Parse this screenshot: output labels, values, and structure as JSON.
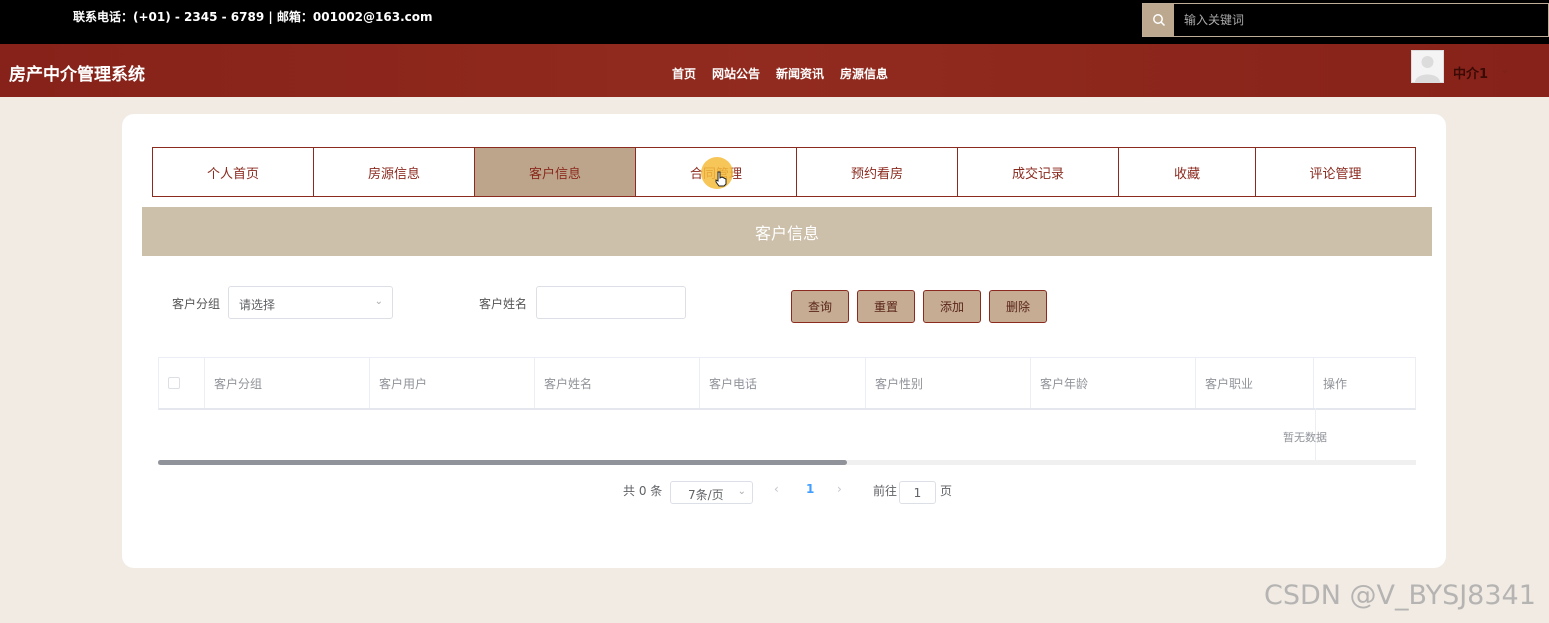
{
  "topbar": {
    "contact": "联系电话：(+01) - 2345 - 6789 | 邮箱：001002@163.com",
    "search_placeholder": "输入关键词",
    "search_icon": "search-icon"
  },
  "header": {
    "title": "房产中介管理系统",
    "nav": [
      "首页",
      "网站公告",
      "新闻资讯",
      "房源信息"
    ],
    "user_name": "中介1",
    "user_caret": "⌄"
  },
  "tabs": [
    {
      "label": "个人首页",
      "active": false
    },
    {
      "label": "房源信息",
      "active": false
    },
    {
      "label": "客户信息",
      "active": true
    },
    {
      "label": "合同管理",
      "active": false
    },
    {
      "label": "预约看房",
      "active": false
    },
    {
      "label": "成交记录",
      "active": false
    },
    {
      "label": "收藏",
      "active": false
    },
    {
      "label": "评论管理",
      "active": false
    }
  ],
  "banner": "客户信息",
  "filters": {
    "group_label": "客户分组",
    "group_value": "请选择",
    "name_label": "客户姓名",
    "name_value": ""
  },
  "buttons": {
    "query": "查询",
    "reset": "重置",
    "add": "添加",
    "delete": "删除"
  },
  "table": {
    "columns": [
      "客户分组",
      "客户用户",
      "客户姓名",
      "客户电话",
      "客户性别",
      "客户年龄",
      "客户职业",
      "操作"
    ],
    "empty_text": "暂无数据"
  },
  "pagination": {
    "total": "共 0 条",
    "page_size": "7条/页",
    "current_page": "1",
    "goto_label": "前往",
    "goto_value": "1",
    "page_suffix": "页"
  },
  "watermark": "CSDN @V_BYSJ8341",
  "colors": {
    "brand_red": "#8b2a1e",
    "accent_tan": "#bca58b",
    "banner": "#cdc0aa"
  }
}
